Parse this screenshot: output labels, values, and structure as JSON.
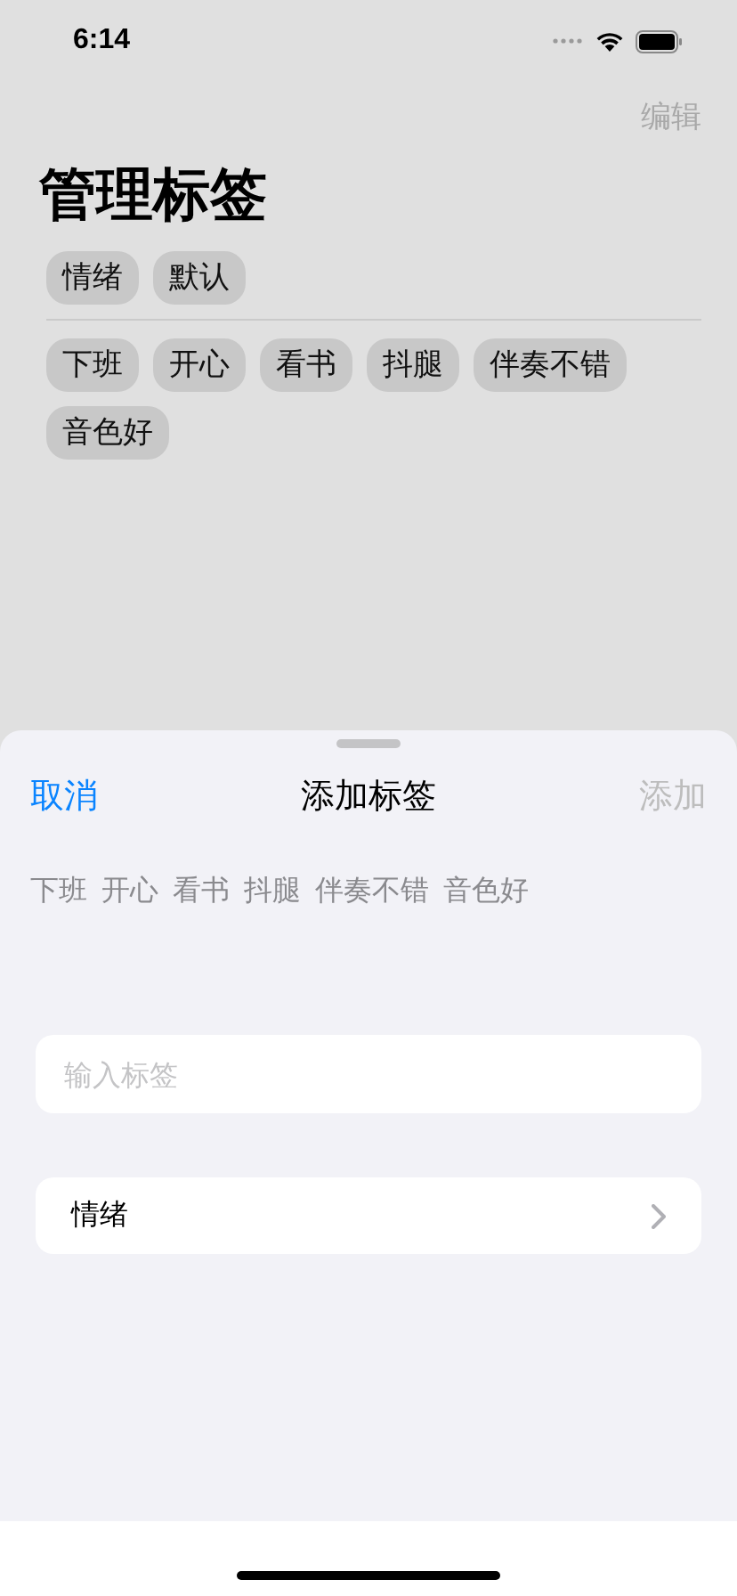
{
  "status_bar": {
    "time": "6:14"
  },
  "nav": {
    "edit": "编辑",
    "title": "管理标签"
  },
  "groups": [
    "情绪",
    "默认"
  ],
  "tags": [
    "下班",
    "开心",
    "看书",
    "抖腿",
    "伴奏不错",
    "音色好"
  ],
  "sheet": {
    "cancel": "取消",
    "title": "添加标签",
    "add": {
      "label": "添加",
      "disabled": true
    },
    "suggestions": [
      "下班",
      "开心",
      "看书",
      "抖腿",
      "伴奏不错",
      "音色好"
    ],
    "input": {
      "placeholder": "输入标签"
    },
    "group_row": {
      "label": "情绪"
    }
  }
}
